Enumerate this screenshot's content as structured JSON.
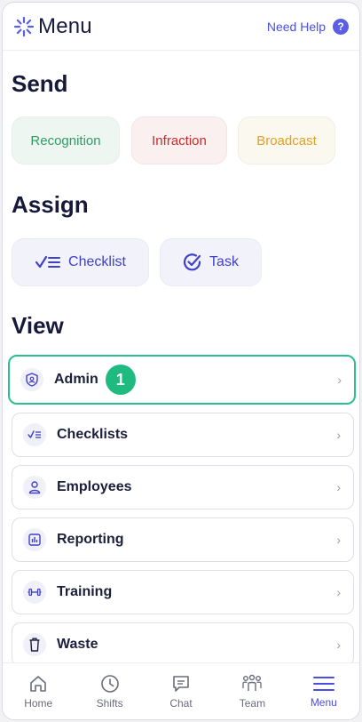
{
  "header": {
    "title": "Menu",
    "help_label": "Need Help",
    "help_icon": "?"
  },
  "sections": {
    "send": "Send",
    "assign": "Assign",
    "view": "View"
  },
  "send": {
    "recognition": "Recognition",
    "infraction": "Infraction",
    "broadcast": "Broadcast"
  },
  "assign": {
    "checklist": "Checklist",
    "task": "Task"
  },
  "view_items": [
    {
      "label": "Admin",
      "icon": "shield-user-icon",
      "badge": "1"
    },
    {
      "label": "Checklists",
      "icon": "checklist-icon"
    },
    {
      "label": "Employees",
      "icon": "person-icon"
    },
    {
      "label": "Reporting",
      "icon": "report-icon"
    },
    {
      "label": "Training",
      "icon": "dumbbell-icon"
    },
    {
      "label": "Waste",
      "icon": "trash-icon"
    }
  ],
  "tabs": [
    {
      "label": "Home",
      "icon": "home-icon"
    },
    {
      "label": "Shifts",
      "icon": "clock-icon"
    },
    {
      "label": "Chat",
      "icon": "chat-icon"
    },
    {
      "label": "Team",
      "icon": "team-icon"
    },
    {
      "label": "Menu",
      "icon": "menu-icon",
      "active": true
    }
  ],
  "colors": {
    "accent": "#4a4ee3",
    "green": "#2e9e63",
    "red": "#d02a2a",
    "amber": "#e3a020",
    "highlight": "#2bbf8c"
  }
}
